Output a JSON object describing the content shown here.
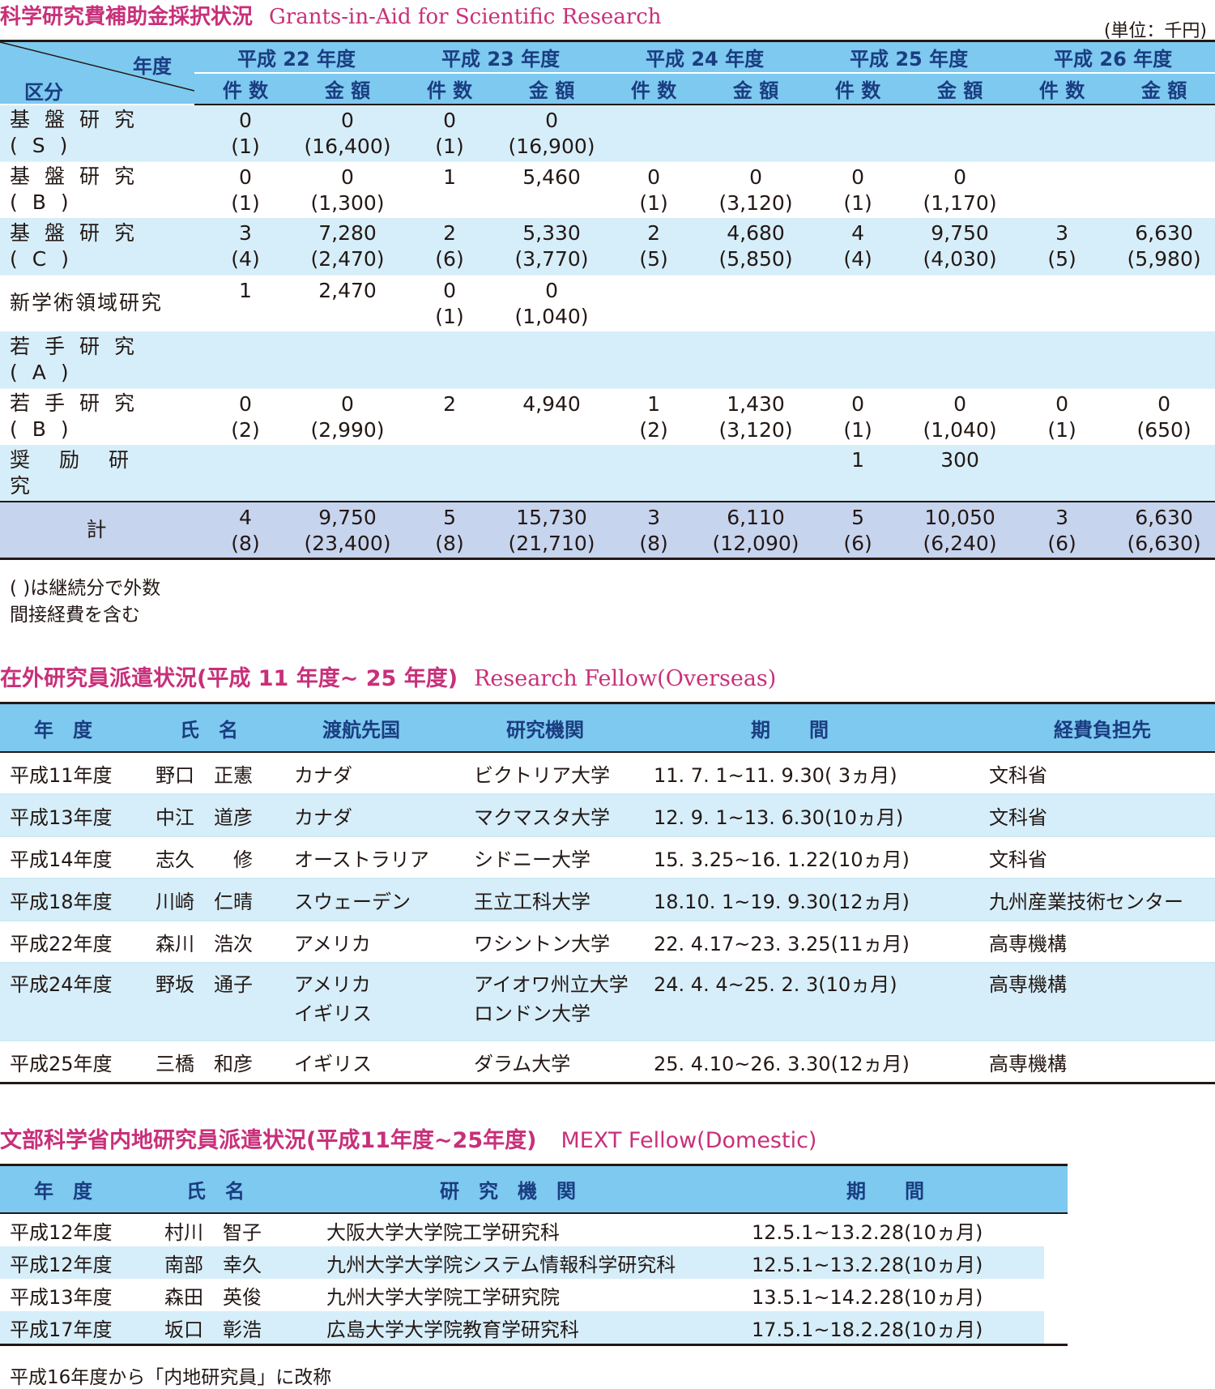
{
  "grants": {
    "title_ja": "科学研究費補助金採択状況",
    "title_en": "Grants-in-Aid for Scientific Research",
    "unit": "(単位：千円)",
    "header": {
      "year_label": "年度",
      "category_label": "区分",
      "years": [
        "平成 22 年度",
        "平成 23 年度",
        "平成 24 年度",
        "平成 25 年度",
        "平成 26 年度"
      ],
      "count_label": "件 数",
      "amount_label": "金 額"
    },
    "rows": [
      {
        "category": "基盤研究(S)",
        "cells": [
          [
            "0",
            "(1)"
          ],
          [
            "0",
            "(16,400)"
          ],
          [
            "0",
            "(1)"
          ],
          [
            "0",
            "(16,900)"
          ],
          [
            "",
            ""
          ],
          [
            "",
            ""
          ],
          [
            "",
            ""
          ],
          [
            "",
            ""
          ],
          [
            "",
            ""
          ],
          [
            "",
            ""
          ]
        ]
      },
      {
        "category": "基盤研究(B)",
        "cells": [
          [
            "0",
            "(1)"
          ],
          [
            "0",
            "(1,300)"
          ],
          [
            "1",
            ""
          ],
          [
            "5,460",
            ""
          ],
          [
            "0",
            "(1)"
          ],
          [
            "0",
            "(3,120)"
          ],
          [
            "0",
            "(1)"
          ],
          [
            "0",
            "(1,170)"
          ],
          [
            "",
            ""
          ],
          [
            "",
            ""
          ]
        ]
      },
      {
        "category": "基盤研究(C)",
        "cells": [
          [
            "3",
            "(4)"
          ],
          [
            "7,280",
            "(2,470)"
          ],
          [
            "2",
            "(6)"
          ],
          [
            "5,330",
            "(3,770)"
          ],
          [
            "2",
            "(5)"
          ],
          [
            "4,680",
            "(5,850)"
          ],
          [
            "4",
            "(4)"
          ],
          [
            "9,750",
            "(4,030)"
          ],
          [
            "3",
            "(5)"
          ],
          [
            "6,630",
            "(5,980)"
          ]
        ]
      },
      {
        "category": "新学術領域研究",
        "cells": [
          [
            "1",
            ""
          ],
          [
            "2,470",
            ""
          ],
          [
            "0",
            "(1)"
          ],
          [
            "0",
            "(1,040)"
          ],
          [
            "",
            ""
          ],
          [
            "",
            ""
          ],
          [
            "",
            ""
          ],
          [
            "",
            ""
          ],
          [
            "",
            ""
          ],
          [
            "",
            ""
          ]
        ]
      },
      {
        "category": "若手研究(A)",
        "cells": [
          [
            "",
            ""
          ],
          [
            "",
            ""
          ],
          [
            "",
            ""
          ],
          [
            "",
            ""
          ],
          [
            "",
            ""
          ],
          [
            "",
            ""
          ],
          [
            "",
            ""
          ],
          [
            "",
            ""
          ],
          [
            "",
            ""
          ],
          [
            "",
            ""
          ]
        ]
      },
      {
        "category": "若手研究(B)",
        "cells": [
          [
            "0",
            "(2)"
          ],
          [
            "0",
            "(2,990)"
          ],
          [
            "2",
            ""
          ],
          [
            "4,940",
            ""
          ],
          [
            "1",
            "(2)"
          ],
          [
            "1,430",
            "(3,120)"
          ],
          [
            "0",
            "(1)"
          ],
          [
            "0",
            "(1,040)"
          ],
          [
            "0",
            "(1)"
          ],
          [
            "0",
            "(650)"
          ]
        ]
      },
      {
        "category": "奨励研究",
        "cells": [
          [
            "",
            ""
          ],
          [
            "",
            ""
          ],
          [
            "",
            ""
          ],
          [
            "",
            ""
          ],
          [
            "",
            ""
          ],
          [
            "",
            ""
          ],
          [
            "1",
            ""
          ],
          [
            "300",
            ""
          ],
          [
            "",
            ""
          ],
          [
            "",
            ""
          ]
        ]
      }
    ],
    "total": {
      "category": "計",
      "cells": [
        [
          "4",
          "(8)"
        ],
        [
          "9,750",
          "(23,400)"
        ],
        [
          "5",
          "(8)"
        ],
        [
          "15,730",
          "(21,710)"
        ],
        [
          "3",
          "(8)"
        ],
        [
          "6,110",
          "(12,090)"
        ],
        [
          "5",
          "(6)"
        ],
        [
          "10,050",
          "(6,240)"
        ],
        [
          "3",
          "(6)"
        ],
        [
          "6,630",
          "(6,630)"
        ]
      ]
    },
    "notes": [
      "( )は継続分で外数",
      "間接経費を含む"
    ]
  },
  "overseas": {
    "title_ja": "在外研究員派遣状況(平成 11 年度~ 25 年度)",
    "title_en": "Research Fellow(Overseas)",
    "headers": [
      "年　度",
      "氏　名",
      "渡航先国",
      "研究機関",
      "期　　間",
      "経費負担先"
    ],
    "rows": [
      [
        "平成11年度",
        "野口　正憲",
        "カナダ",
        "ビクトリア大学",
        "11. 7. 1~11. 9.30( 3ヵ月)",
        "文科省"
      ],
      [
        "平成13年度",
        "中江　道彦",
        "カナダ",
        "マクマスタ大学",
        "12. 9. 1~13. 6.30(10ヵ月)",
        "文科省"
      ],
      [
        "平成14年度",
        "志久　　修",
        "オーストラリア",
        "シドニー大学",
        "15. 3.25~16. 1.22(10ヵ月)",
        "文科省"
      ],
      [
        "平成18年度",
        "川崎　仁晴",
        "スウェーデン",
        "王立工科大学",
        "18.10. 1~19. 9.30(12ヵ月)",
        "九州産業技術センター"
      ],
      [
        "平成22年度",
        "森川　浩次",
        "アメリカ",
        "ワシントン大学",
        "22. 4.17~23. 3.25(11ヵ月)",
        "高専機構"
      ],
      [
        "平成24年度",
        "野坂　通子",
        "アメリカ\nイギリス",
        "アイオワ州立大学\nロンドン大学",
        "24. 4. 4~25. 2. 3(10ヵ月)",
        "高専機構"
      ],
      [
        "平成25年度",
        "三橋　和彦",
        "イギリス",
        "ダラム大学",
        "25. 4.10~26. 3.30(12ヵ月)",
        "高専機構"
      ]
    ]
  },
  "domestic": {
    "title_ja": "文部科学省内地研究員派遣状況(平成11年度~25年度)",
    "title_en": "MEXT Fellow(Domestic)",
    "headers": [
      "年　度",
      "氏　名",
      "研　究　機　関",
      "期　　間"
    ],
    "rows": [
      [
        "平成12年度",
        "村川　智子",
        "大阪大学大学院工学研究科",
        "12.5.1~13.2.28(10ヵ月)"
      ],
      [
        "平成12年度",
        "南部　幸久",
        "九州大学大学院システム情報科学研究科",
        "12.5.1~13.2.28(10ヵ月)"
      ],
      [
        "平成13年度",
        "森田　英俊",
        "九州大学大学院工学研究院",
        "13.5.1~14.2.28(10ヵ月)"
      ],
      [
        "平成17年度",
        "坂口　彰浩",
        "広島大学大学院教育学研究科",
        "17.5.1~18.2.28(10ヵ月)"
      ]
    ],
    "note": "平成16年度から「内地研究員」に改称"
  },
  "colors": {
    "title": "#c8307a",
    "header_bg": "#7ec9ef",
    "header_text": "#1a3d80",
    "band": "#d6eef9",
    "total_bg": "#c7d4ee"
  }
}
